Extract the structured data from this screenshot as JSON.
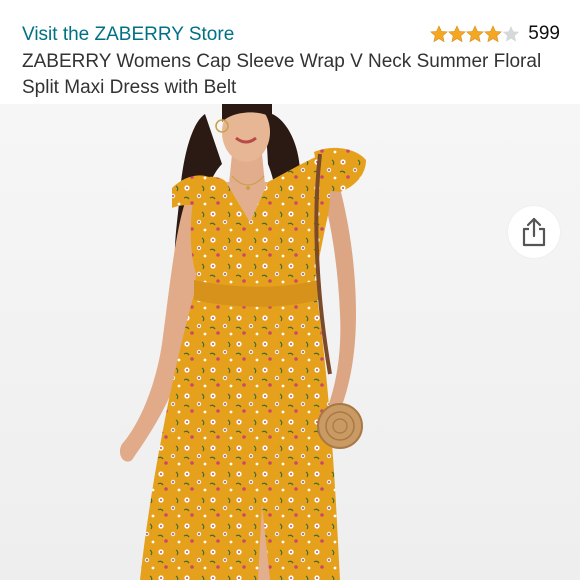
{
  "store": {
    "link_text": "Visit the ZABERRY Store"
  },
  "rating": {
    "stars": 4,
    "max_stars": 5,
    "count": "599",
    "star_color": "#f5a623",
    "empty_star_color": "#d5d9d9"
  },
  "product": {
    "title": "ZABERRY Womens Cap Sleeve Wrap V Neck Summer Floral Split Maxi Dress with Belt",
    "dress_color": "#e6a11c"
  },
  "actions": {
    "share_icon": "share-icon"
  },
  "colors": {
    "link": "#007185",
    "text": "#333333",
    "image_background": "#f5f5f5"
  }
}
